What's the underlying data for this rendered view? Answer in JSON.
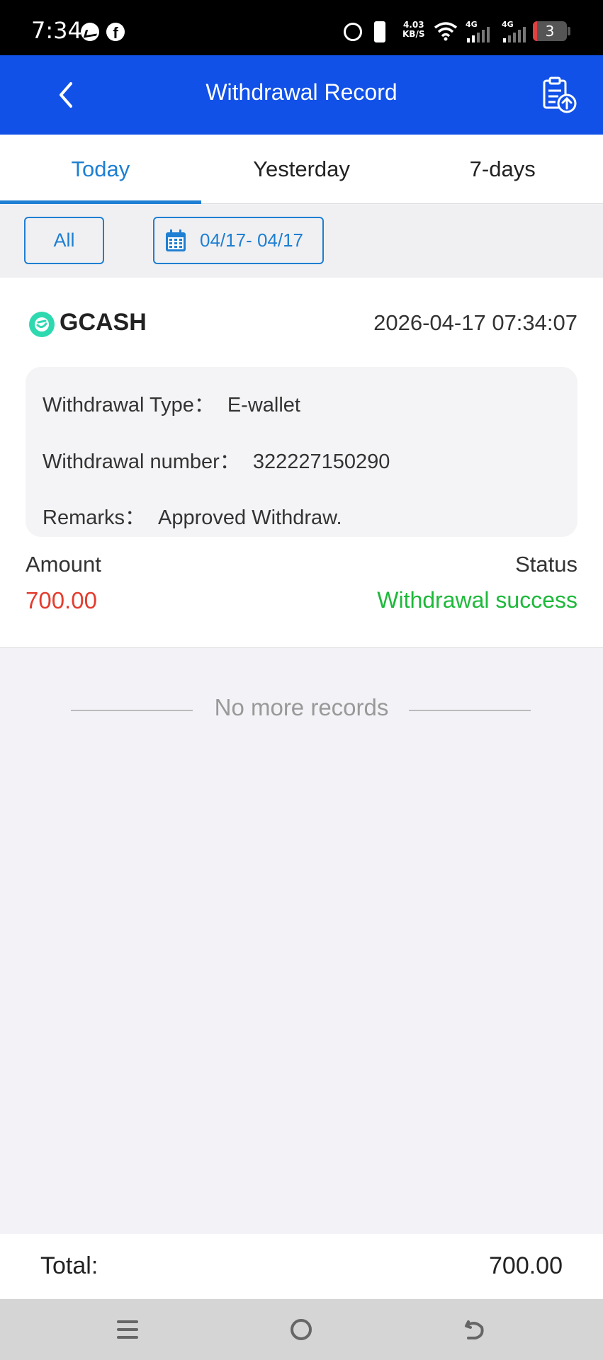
{
  "status_bar": {
    "time": "7:34",
    "net_speed_value": "4.03",
    "net_speed_unit": "KB/S",
    "signal1_label": "4G",
    "signal2_label": "4G",
    "battery_level": "3",
    "icons": [
      "messenger-icon",
      "facebook-icon",
      "alarm-icon",
      "vibrate-icon",
      "wifi-icon",
      "signal-icon",
      "battery-icon"
    ]
  },
  "header": {
    "title": "Withdrawal Record",
    "back_icon": "chevron-left-icon",
    "action_icon": "clipboard-upload-icon",
    "bg_color": "#1151e8"
  },
  "tabs": [
    {
      "label": "Today",
      "active": true
    },
    {
      "label": "Yesterday",
      "active": false
    },
    {
      "label": "7-days",
      "active": false
    }
  ],
  "filter": {
    "all_label": "All",
    "date_range": "04/17- 04/17",
    "date_icon": "calendar-icon"
  },
  "record": {
    "method": "GCASH",
    "method_icon": "gcash-logo",
    "datetime": "2026-04-17 07:34:07",
    "type_label": "Withdrawal Type：",
    "type_value": "E-wallet",
    "number_label": "Withdrawal number：",
    "number_value": "322227150290",
    "remarks_label": "Remarks：",
    "remarks_value": "Approved Withdraw.",
    "amount_label": "Amount",
    "amount_value": "700.00",
    "status_label": "Status",
    "status_value": "Withdrawal success",
    "amount_color": "#e43d2f",
    "status_color": "#1eb93b"
  },
  "list_end": "No more records",
  "footer": {
    "total_label": "Total:",
    "total_value": "700.00"
  },
  "accent_color": "#1f7fd2"
}
